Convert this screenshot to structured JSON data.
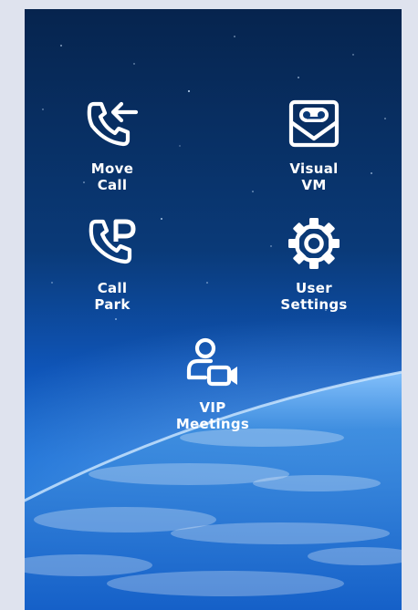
{
  "tiles": {
    "move_call": {
      "line1": "Move",
      "line2": "Call"
    },
    "visual_vm": {
      "line1": "Visual",
      "line2": "VM"
    },
    "call_park": {
      "line1": "Call",
      "line2": "Park"
    },
    "user_settings": {
      "line1": "User",
      "line2": "Settings"
    },
    "vip_meetings": {
      "line1": "VIP",
      "line2": "Meetings"
    }
  },
  "icons": {
    "move_call": "phone-arrow-icon",
    "visual_vm": "voicemail-envelope-icon",
    "call_park": "phone-park-icon",
    "user_settings": "gear-icon",
    "vip_meetings": "user-video-icon"
  },
  "colors": {
    "page_background": "#dfe3ee",
    "space_top": "#06244e",
    "earth_glow": "#2f86dc",
    "icon_and_text": "#ffffff"
  }
}
